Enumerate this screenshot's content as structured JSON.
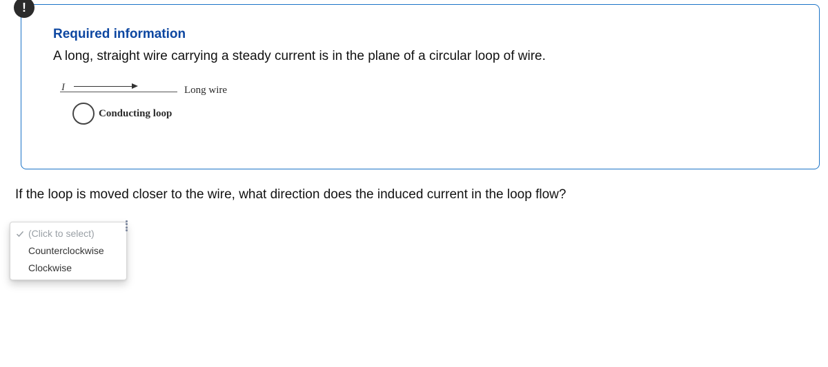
{
  "info": {
    "badge_glyph": "!",
    "title": "Required information",
    "body": "A long, straight wire carrying a steady current is in the plane of a circular loop of wire.",
    "diagram": {
      "current_symbol": "I",
      "wire_label": "Long wire",
      "loop_label": "Conducting loop"
    }
  },
  "question": "If the loop is moved closer to the wire, what direction does the induced current in the loop flow?",
  "select": {
    "placeholder": "(Click to select)",
    "options": [
      "Counterclockwise",
      "Clockwise"
    ],
    "selected_index": null
  }
}
